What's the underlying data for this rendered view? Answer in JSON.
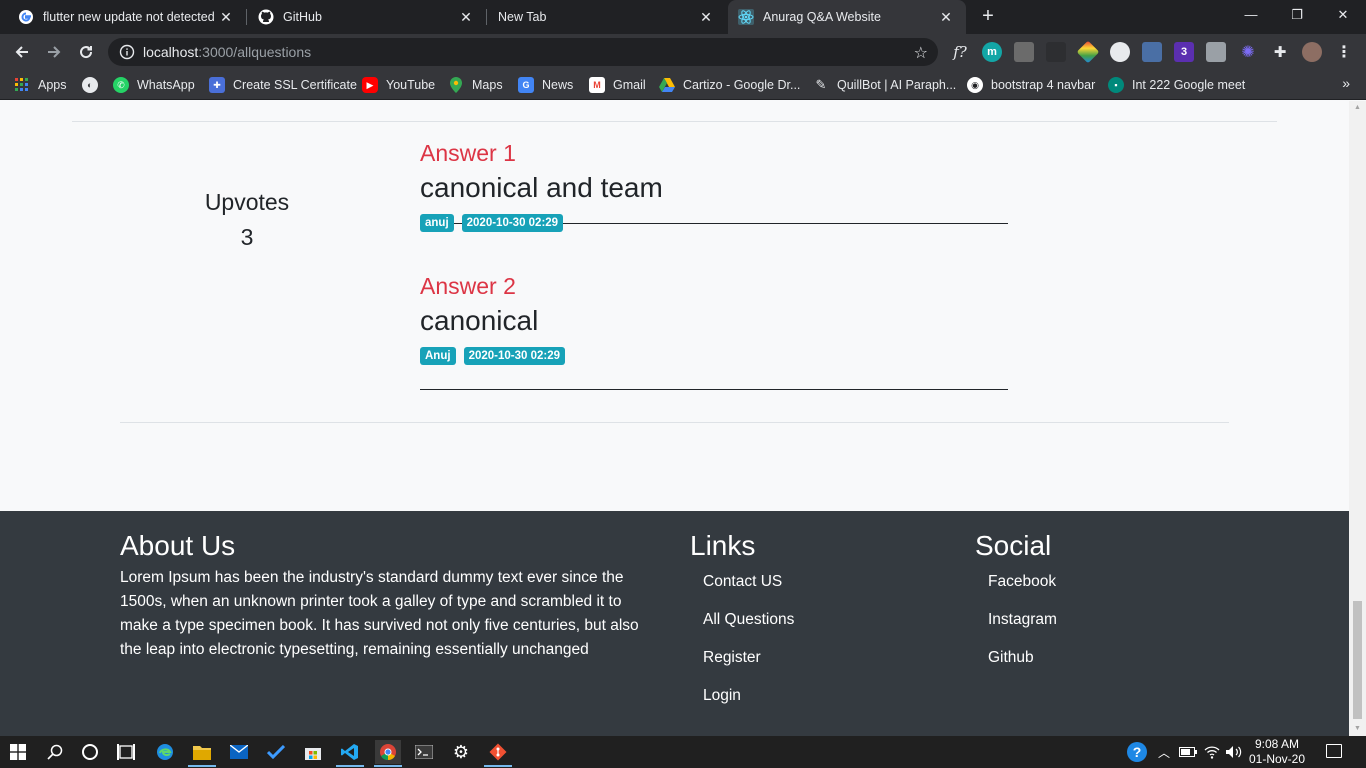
{
  "browser": {
    "tabs": [
      {
        "title": "flutter new update not detected",
        "favicon": "google-g-icon",
        "active": false
      },
      {
        "title": "GitHub",
        "favicon": "github-icon",
        "active": false
      },
      {
        "title": "New Tab",
        "favicon": "",
        "active": false
      },
      {
        "title": "Anurag Q&A Website",
        "favicon": "react-icon",
        "active": true
      }
    ],
    "url_host": "localhost",
    "url_path": ":3000/allquestions",
    "extensions": [
      "f?",
      "m",
      "",
      "",
      "",
      "",
      "",
      "3",
      "",
      "",
      "puzzle-icon",
      "avatar"
    ],
    "bookmarks": [
      {
        "label": "Apps",
        "icon": "apps-grid-icon"
      },
      {
        "label": "",
        "icon": "globe-icon"
      },
      {
        "label": "WhatsApp",
        "icon": "whatsapp-icon"
      },
      {
        "label": "Create SSL Certificate",
        "icon": "puzzle-icon"
      },
      {
        "label": "YouTube",
        "icon": "youtube-icon"
      },
      {
        "label": "Maps",
        "icon": "maps-pin-icon"
      },
      {
        "label": "News",
        "icon": "news-icon"
      },
      {
        "label": "Gmail",
        "icon": "gmail-icon"
      },
      {
        "label": "Cartizo - Google Dr...",
        "icon": "drive-icon"
      },
      {
        "label": "QuillBot | AI Paraph...",
        "icon": "quill-icon"
      },
      {
        "label": "bootstrap 4 navbar",
        "icon": "github-icon"
      },
      {
        "label": "Int 222 Google meet",
        "icon": "meet-icon"
      }
    ]
  },
  "question": {
    "upvotes_label": "Upvotes",
    "upvotes_count": "3",
    "answers": [
      {
        "heading": "Answer 1",
        "text": "canonical and team",
        "user": "anuj",
        "date": "2020-10-30 02:29"
      },
      {
        "heading": "Answer 2",
        "text": "canonical",
        "user": "Anuj",
        "date": "2020-10-30 02:29"
      }
    ]
  },
  "footer": {
    "about_title": "About Us",
    "about_text": "Lorem Ipsum has been the industry's standard dummy text ever since the 1500s, when an unknown printer took a galley of type and scrambled it to make a type specimen book. It has survived not only five centuries, but also the leap into electronic typesetting, remaining essentially unchanged",
    "links_title": "Links",
    "links": [
      "Contact US",
      "All Questions",
      "Register",
      "Login"
    ],
    "social_title": "Social",
    "social": [
      "Facebook",
      "Instagram",
      "Github"
    ]
  },
  "taskbar": {
    "time": "9:08 AM",
    "date": "01-Nov-20"
  },
  "colors": {
    "answer_heading": "#dc3545",
    "badge": "#17a2b8",
    "footer_bg": "#343a40"
  }
}
